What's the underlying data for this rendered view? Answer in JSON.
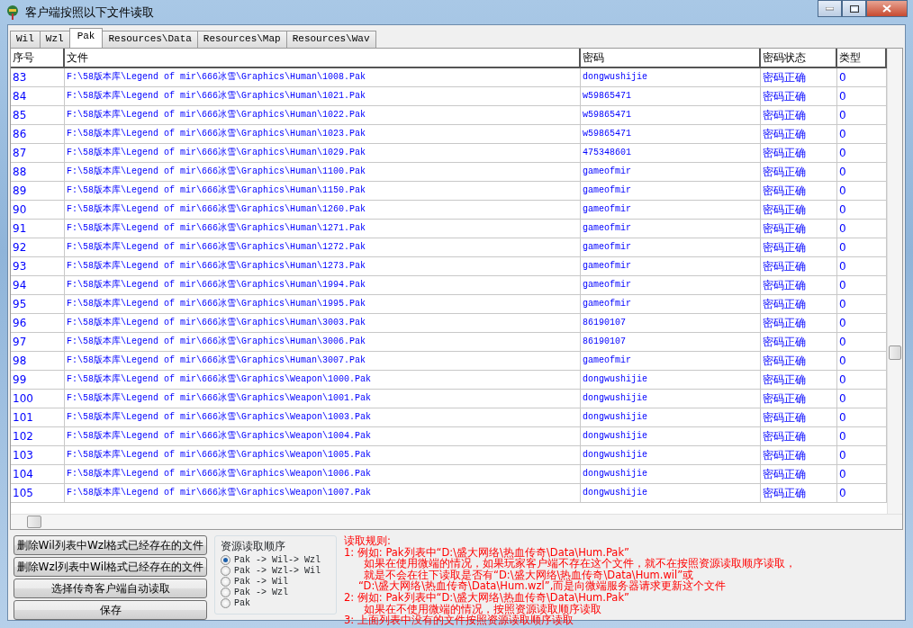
{
  "window": {
    "title": "客户端按照以下文件读取"
  },
  "tabs": [
    {
      "label": "Wil",
      "selected": false
    },
    {
      "label": "Wzl",
      "selected": false
    },
    {
      "label": "Pak",
      "selected": true
    },
    {
      "label": "Resources\\Data",
      "selected": false
    },
    {
      "label": "Resources\\Map",
      "selected": false
    },
    {
      "label": "Resources\\Wav",
      "selected": false
    }
  ],
  "table": {
    "columns": [
      "序号",
      "文件",
      "密码",
      "密码状态",
      "类型"
    ],
    "rows": [
      [
        "83",
        "F:\\58版本库\\Legend of mir\\666冰雪\\Graphics\\Human\\1008.Pak",
        "dongwushijie",
        "密码正确",
        "0"
      ],
      [
        "84",
        "F:\\58版本库\\Legend of mir\\666冰雪\\Graphics\\Human\\1021.Pak",
        "w59865471",
        "密码正确",
        "0"
      ],
      [
        "85",
        "F:\\58版本库\\Legend of mir\\666冰雪\\Graphics\\Human\\1022.Pak",
        "w59865471",
        "密码正确",
        "0"
      ],
      [
        "86",
        "F:\\58版本库\\Legend of mir\\666冰雪\\Graphics\\Human\\1023.Pak",
        "w59865471",
        "密码正确",
        "0"
      ],
      [
        "87",
        "F:\\58版本库\\Legend of mir\\666冰雪\\Graphics\\Human\\1029.Pak",
        "475348601",
        "密码正确",
        "0"
      ],
      [
        "88",
        "F:\\58版本库\\Legend of mir\\666冰雪\\Graphics\\Human\\1100.Pak",
        "gameofmir",
        "密码正确",
        "0"
      ],
      [
        "89",
        "F:\\58版本库\\Legend of mir\\666冰雪\\Graphics\\Human\\1150.Pak",
        "gameofmir",
        "密码正确",
        "0"
      ],
      [
        "90",
        "F:\\58版本库\\Legend of mir\\666冰雪\\Graphics\\Human\\1260.Pak",
        "gameofmir",
        "密码正确",
        "0"
      ],
      [
        "91",
        "F:\\58版本库\\Legend of mir\\666冰雪\\Graphics\\Human\\1271.Pak",
        "gameofmir",
        "密码正确",
        "0"
      ],
      [
        "92",
        "F:\\58版本库\\Legend of mir\\666冰雪\\Graphics\\Human\\1272.Pak",
        "gameofmir",
        "密码正确",
        "0"
      ],
      [
        "93",
        "F:\\58版本库\\Legend of mir\\666冰雪\\Graphics\\Human\\1273.Pak",
        "gameofmir",
        "密码正确",
        "0"
      ],
      [
        "94",
        "F:\\58版本库\\Legend of mir\\666冰雪\\Graphics\\Human\\1994.Pak",
        "gameofmir",
        "密码正确",
        "0"
      ],
      [
        "95",
        "F:\\58版本库\\Legend of mir\\666冰雪\\Graphics\\Human\\1995.Pak",
        "gameofmir",
        "密码正确",
        "0"
      ],
      [
        "96",
        "F:\\58版本库\\Legend of mir\\666冰雪\\Graphics\\Human\\3003.Pak",
        "86190107",
        "密码正确",
        "0"
      ],
      [
        "97",
        "F:\\58版本库\\Legend of mir\\666冰雪\\Graphics\\Human\\3006.Pak",
        "86190107",
        "密码正确",
        "0"
      ],
      [
        "98",
        "F:\\58版本库\\Legend of mir\\666冰雪\\Graphics\\Human\\3007.Pak",
        "gameofmir",
        "密码正确",
        "0"
      ],
      [
        "99",
        "F:\\58版本库\\Legend of mir\\666冰雪\\Graphics\\Weapon\\1000.Pak",
        "dongwushijie",
        "密码正确",
        "0"
      ],
      [
        "100",
        "F:\\58版本库\\Legend of mir\\666冰雪\\Graphics\\Weapon\\1001.Pak",
        "dongwushijie",
        "密码正确",
        "0"
      ],
      [
        "101",
        "F:\\58版本库\\Legend of mir\\666冰雪\\Graphics\\Weapon\\1003.Pak",
        "dongwushijie",
        "密码正确",
        "0"
      ],
      [
        "102",
        "F:\\58版本库\\Legend of mir\\666冰雪\\Graphics\\Weapon\\1004.Pak",
        "dongwushijie",
        "密码正确",
        "0"
      ],
      [
        "103",
        "F:\\58版本库\\Legend of mir\\666冰雪\\Graphics\\Weapon\\1005.Pak",
        "dongwushijie",
        "密码正确",
        "0"
      ],
      [
        "104",
        "F:\\58版本库\\Legend of mir\\666冰雪\\Graphics\\Weapon\\1006.Pak",
        "dongwushijie",
        "密码正确",
        "0"
      ],
      [
        "105",
        "F:\\58版本库\\Legend of mir\\666冰雪\\Graphics\\Weapon\\1007.Pak",
        "dongwushijie",
        "密码正确",
        "0"
      ]
    ]
  },
  "buttons": [
    "删除Wil列表中Wzl格式已经存在的文件",
    "删除Wzl列表中Wil格式已经存在的文件",
    "选择传奇客户端自动读取",
    "保存"
  ],
  "read_order": {
    "title": "资源读取顺序",
    "options": [
      {
        "label": "Pak -> Wil-> Wzl",
        "selected": true
      },
      {
        "label": "Pak -> Wzl-> Wil",
        "selected": false
      },
      {
        "label": "Pak -> Wil",
        "selected": false
      },
      {
        "label": "Pak -> Wzl",
        "selected": false
      },
      {
        "label": "Pak",
        "selected": false
      }
    ]
  },
  "rules": [
    {
      "kind": "heading",
      "text": "读取规则:"
    },
    {
      "kind": "item",
      "text": "1: 例如: Pak列表中“D:\\盛大网络\\热血传奇\\Data\\Hum.Pak”"
    },
    {
      "kind": "continuation",
      "text": "如果在使用微端的情况，如果玩家客户端不存在这个文件，就不在按照资源读取顺序读取，"
    },
    {
      "kind": "continuation",
      "text": "就是不会在往下读取是否有“D:\\盛大网络\\热血传奇\\Data\\Hum.wil”或"
    },
    {
      "kind": "quote",
      "text": "“D:\\盛大网络\\热血传奇\\Data\\Hum.wzl”,而是向微端服务器请求更新这个文件"
    },
    {
      "kind": "item",
      "text": "2: 例如: Pak列表中“D:\\盛大网络\\热血传奇\\Data\\Hum.Pak”"
    },
    {
      "kind": "continuation",
      "text": "如果在不使用微端的情况，按照资源读取顺序读取"
    },
    {
      "kind": "item",
      "text": "3: 上面列表中没有的文件按照资源读取顺序读取"
    }
  ]
}
